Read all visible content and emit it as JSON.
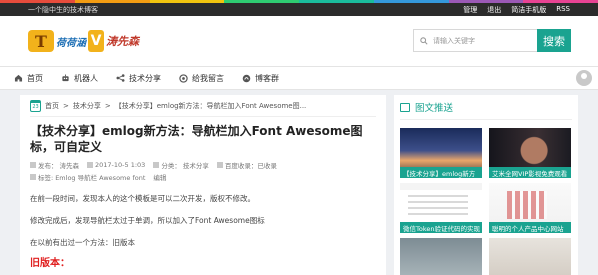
{
  "topbar": {
    "tagline": "一个隐中生的技术博客",
    "links": [
      "管理",
      "退出",
      "简洁手机版",
      "RSS"
    ]
  },
  "logo": {
    "t": "T",
    "text1": "荷荷涵",
    "v": "V",
    "text2": "涛先森"
  },
  "search": {
    "placeholder": "请输入关键字",
    "button": "搜索"
  },
  "nav": {
    "items": [
      {
        "label": "首页",
        "icon": "home-icon"
      },
      {
        "label": "机器人",
        "icon": "robot-icon"
      },
      {
        "label": "技术分享",
        "icon": "share-icon"
      },
      {
        "label": "给我留言",
        "icon": "message-icon"
      },
      {
        "label": "博客群",
        "icon": "group-icon"
      }
    ]
  },
  "breadcrumb": {
    "cal_day": "23",
    "items": [
      "首页",
      ">",
      "技术分享",
      ">",
      "【技术分享】emlog新方法：导航栏加入Font Awesome图..."
    ]
  },
  "article": {
    "title": "【技术分享】emlog新方法：导航栏加入Font Awesome图标，可自定义",
    "meta": {
      "author_label": "发布：",
      "author": "涛先森",
      "date": "2017-10-5 1:03",
      "category_label": "分类：",
      "category": "技术分享",
      "baidu": "百度收录：已收录",
      "tags_label": "标签:",
      "tags": "Emlog  导航栏  Awesome  font",
      "edit": "编辑"
    },
    "paragraphs": [
      "在前一段时间，发现本人的这个模板是可以二次开发，版权不修改。",
      "修改完成后，发现导航栏太过于单调，所以加入了Font Awesome图标",
      "在以前有出过一个方法：旧版本"
    ],
    "red_heading": "旧版本："
  },
  "sidebar": {
    "title": "图文推送",
    "cards": [
      {
        "caption": "【技术分享】emlog新方"
      },
      {
        "caption": "艾米全网VIP影视免费观看"
      },
      {
        "caption": "微信Token验证代码的实现"
      },
      {
        "caption": "聪明的个人产品中心网站"
      },
      {
        "caption": ""
      },
      {
        "caption": ""
      }
    ]
  },
  "colors": {
    "accent": "#1aa390",
    "bar": [
      "#e74c3c",
      "#f39c12",
      "#f1c40f",
      "#2ecc71",
      "#1abc9c",
      "#3498db",
      "#9b59b6",
      "#e84393"
    ]
  }
}
